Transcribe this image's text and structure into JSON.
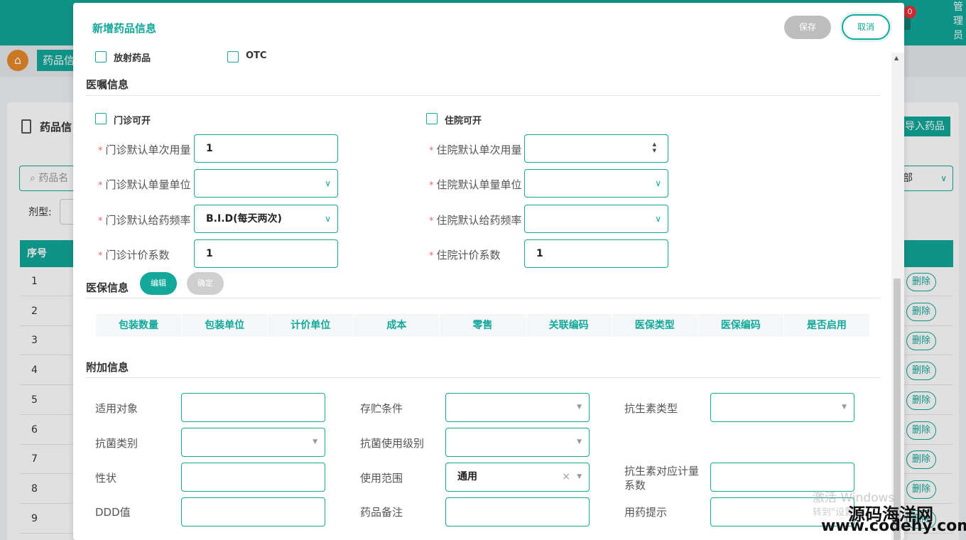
{
  "topbar": {
    "badge": "0",
    "admin": "管理员"
  },
  "background": {
    "tab_label": "药品信",
    "card_title": "药品信",
    "import_button": "导入药品",
    "search_placeholder": "药品名",
    "filter_value": "部",
    "dosage_label": "剂型:",
    "table_header_no": "序号",
    "rows": [
      "1",
      "2",
      "3",
      "4",
      "5",
      "6",
      "7",
      "8",
      "9"
    ],
    "delete_label": "删除"
  },
  "modal": {
    "title": "新增药品信息",
    "save": "保存",
    "cancel": "取消",
    "top_checks": {
      "radioactive": "放射药品",
      "otc": "OTC"
    },
    "order_section": {
      "title": "医嘱信息",
      "outpatient_enable": "门诊可开",
      "inpatient_enable": "住院可开",
      "outpatient": {
        "dose_label": "门诊默认单次用量",
        "dose_value": "1",
        "unit_label": "门诊默认单量单位",
        "unit_value": "",
        "freq_label": "门诊默认给药频率",
        "freq_value": "B.I.D(每天两次)",
        "price_label": "门诊计价系数",
        "price_value": "1"
      },
      "inpatient": {
        "dose_label": "住院默认单次用量",
        "dose_value": "",
        "unit_label": "住院默认单量单位",
        "unit_value": "",
        "freq_label": "住院默认给药频率",
        "freq_value": "",
        "price_label": "住院计价系数",
        "price_value": "1"
      }
    },
    "insurance_section": {
      "title": "医保信息",
      "edit": "编辑",
      "confirm": "确定",
      "columns": [
        "包装数量",
        "包装单位",
        "计价单位",
        "成本",
        "零售",
        "关联编码",
        "医保类型",
        "医保编码",
        "是否启用"
      ]
    },
    "extra_section": {
      "title": "附加信息",
      "fields": {
        "target": {
          "label": "适用对象",
          "value": ""
        },
        "storage": {
          "label": "存贮条件",
          "value": ""
        },
        "antibiotic_type": {
          "label": "抗生素类型",
          "value": ""
        },
        "antibacterial_class": {
          "label": "抗菌类别",
          "value": ""
        },
        "antibacterial_level": {
          "label": "抗菌使用级别",
          "value": ""
        },
        "property": {
          "label": "性状",
          "value": ""
        },
        "scope": {
          "label": "使用范围",
          "value": "通用"
        },
        "antibiotic_factor": {
          "label": "抗生素对应计量系数",
          "value": ""
        },
        "ddd": {
          "label": "DDD值",
          "value": ""
        },
        "remark": {
          "label": "药品备注",
          "value": ""
        },
        "hint": {
          "label": "用药提示",
          "value": ""
        }
      }
    }
  },
  "overlay_text": {
    "activate_1": "激活 Windows",
    "activate_2": "转到\"设置",
    "brand_cn": "源码海洋网",
    "brand_url": "www.codehy.com"
  }
}
